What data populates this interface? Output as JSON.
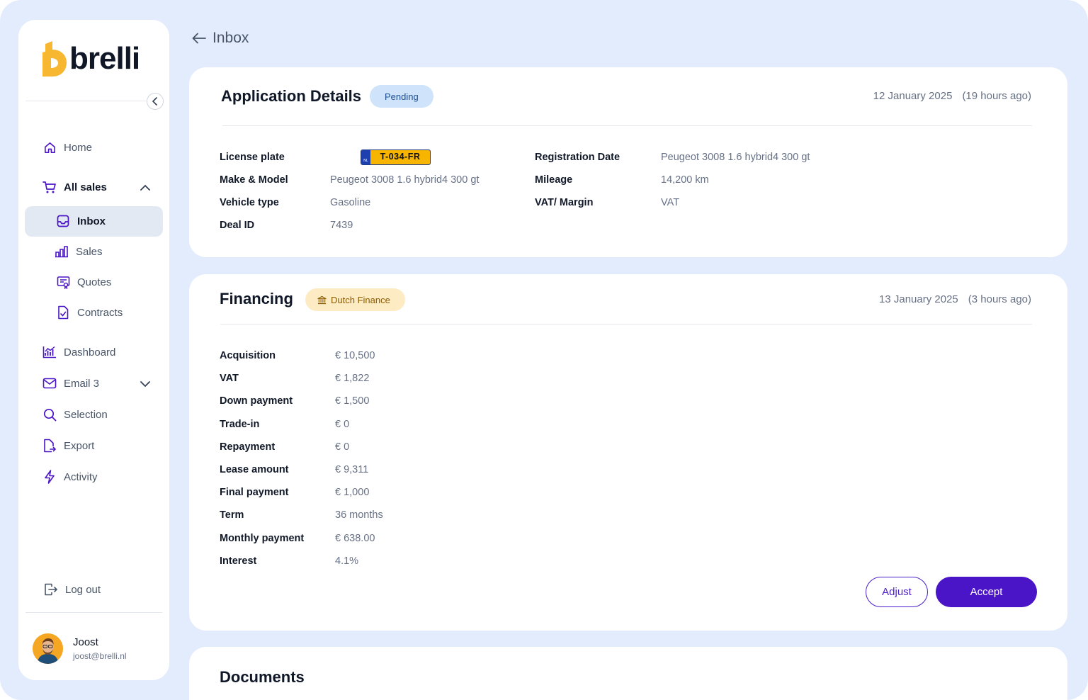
{
  "brand": {
    "name": "brelli",
    "accent": "#4a14c7",
    "logo_yellow": "#f7b731"
  },
  "sidebar": {
    "items": [
      {
        "label": "Home",
        "icon": "home-icon"
      },
      {
        "label": "All sales",
        "icon": "cart-icon"
      },
      {
        "label": "Inbox",
        "icon": "inbox-icon"
      },
      {
        "label": "Sales",
        "icon": "bar-chart-icon"
      },
      {
        "label": "Quotes",
        "icon": "quote-icon"
      },
      {
        "label": "Contracts",
        "icon": "contract-icon"
      },
      {
        "label": "Dashboard",
        "icon": "dashboard-icon"
      },
      {
        "label": "Email 3",
        "icon": "mail-icon"
      },
      {
        "label": "Selection",
        "icon": "search-icon"
      },
      {
        "label": "Export",
        "icon": "export-icon"
      },
      {
        "label": "Activity",
        "icon": "bolt-icon"
      }
    ],
    "logout_label": "Log out",
    "user": {
      "name": "Joost",
      "email": "joost@brelli.nl"
    }
  },
  "breadcrumb": {
    "label": "Inbox"
  },
  "application": {
    "title": "Application Details",
    "status": "Pending",
    "date": "12 January  2025",
    "ago": "(19 hours ago)",
    "left": [
      {
        "label": "License plate",
        "value": "T-034-FR"
      },
      {
        "label": "Make & Model",
        "value": "Peugeot 3008 1.6 hybrid4 300 gt"
      },
      {
        "label": "Vehicle type",
        "value": "Gasoline"
      },
      {
        "label": "Deal ID",
        "value": "7439"
      }
    ],
    "right": [
      {
        "label": "Registration Date",
        "value": "Peugeot 3008 1.6 hybrid4 300 gt"
      },
      {
        "label": "Mileage",
        "value": "14,200 km"
      },
      {
        "label": "VAT/ Margin",
        "value": "VAT"
      }
    ],
    "plate_country": "NL"
  },
  "financing": {
    "title": "Financing",
    "provider": "Dutch Finance",
    "date": "13 January  2025",
    "ago": "(3 hours ago)",
    "rows": [
      {
        "label": "Acquisition",
        "value": "€ 10,500"
      },
      {
        "label": "VAT",
        "value": "€ 1,822"
      },
      {
        "label": "Down payment",
        "value": "€ 1,500"
      },
      {
        "label": "Trade-in",
        "value": "€ 0"
      },
      {
        "label": "Repayment",
        "value": "€ 0"
      },
      {
        "label": "Lease amount",
        "value": "€ 9,311"
      },
      {
        "label": "Final payment",
        "value": "€ 1,000"
      },
      {
        "label": "Term",
        "value": "36 months"
      },
      {
        "label": "Monthly payment",
        "value": "€ 638.00"
      },
      {
        "label": "Interest",
        "value": "4.1%"
      }
    ],
    "adjust_label": "Adjust",
    "accept_label": "Accept"
  },
  "documents": {
    "title": "Documents"
  }
}
